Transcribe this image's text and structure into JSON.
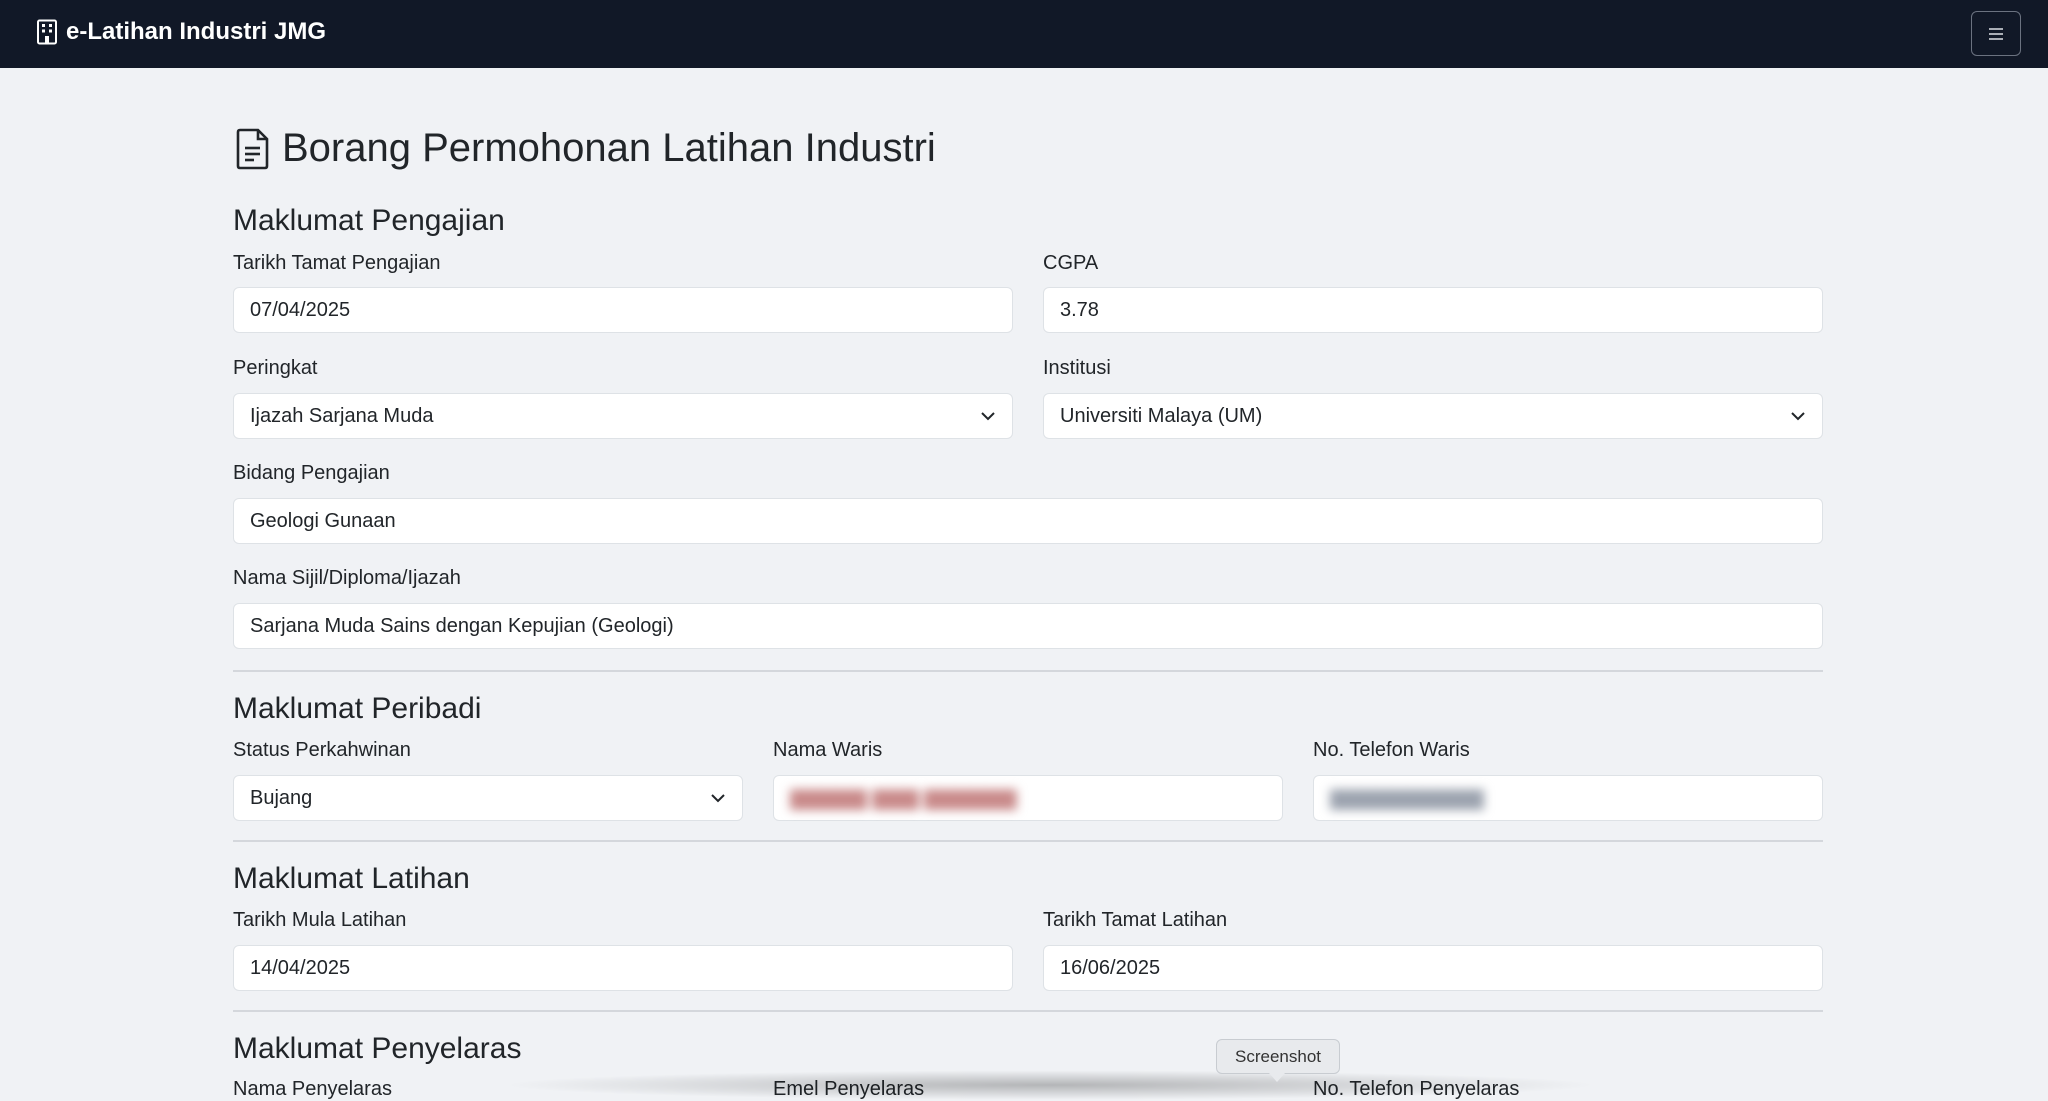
{
  "navbar": {
    "brand": "e-Latihan Industri JMG",
    "brand_icon": "building-icon",
    "menu_icon": "hamburger-icon"
  },
  "page": {
    "title": "Borang Permohonan Latihan Industri",
    "title_icon": "document-icon"
  },
  "pengajian": {
    "title": "Maklumat Pengajian",
    "tarikh_tamat_label": "Tarikh Tamat Pengajian",
    "tarikh_tamat_value": "07/04/2025",
    "cgpa_label": "CGPA",
    "cgpa_value": "3.78",
    "peringkat_label": "Peringkat",
    "peringkat_value": "Ijazah Sarjana Muda",
    "institusi_label": "Institusi",
    "institusi_value": "Universiti Malaya (UM)",
    "bidang_label": "Bidang Pengajian",
    "bidang_value": "Geologi Gunaan",
    "nama_sijil_label": "Nama Sijil/Diploma/Ijazah",
    "nama_sijil_value": "Sarjana Muda Sains dengan Kepujian (Geologi)"
  },
  "peribadi": {
    "title": "Maklumat Peribadi",
    "status_label": "Status Perkahwinan",
    "status_value": "Bujang",
    "nama_waris_label": "Nama Waris",
    "telefon_waris_label": "No. Telefon Waris"
  },
  "latihan": {
    "title": "Maklumat Latihan",
    "mula_label": "Tarikh Mula Latihan",
    "mula_value": "14/04/2025",
    "tamat_label": "Tarikh Tamat Latihan",
    "tamat_value": "16/06/2025"
  },
  "penyelaras": {
    "title": "Maklumat Penyelaras",
    "nama_label": "Nama Penyelaras",
    "emel_label": "Emel Penyelaras",
    "telefon_label": "No. Telefon Penyelaras"
  },
  "tooltip": "Screenshot"
}
